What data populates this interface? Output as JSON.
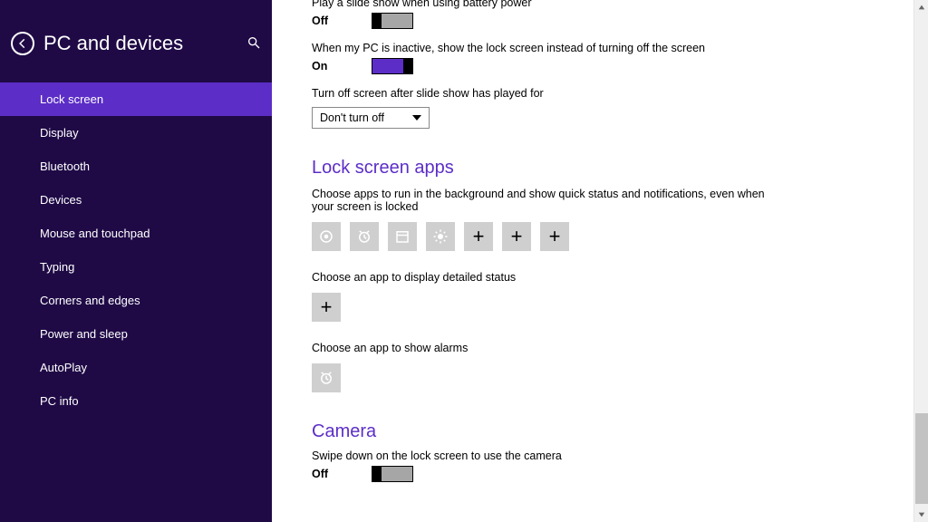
{
  "header": {
    "title": "PC and devices"
  },
  "sidebar": {
    "items": [
      "Lock screen",
      "Display",
      "Bluetooth",
      "Devices",
      "Mouse and touchpad",
      "Typing",
      "Corners and edges",
      "Power and sleep",
      "AutoPlay",
      "PC info"
    ],
    "active_index": 0
  },
  "slideshow": {
    "battery_label": "Play a slide show when using battery power",
    "battery_state": "Off",
    "inactive_label": "When my PC is inactive, show the lock screen instead of turning off the screen",
    "inactive_state": "On",
    "turnoff_label": "Turn off screen after slide show has played for",
    "turnoff_selected": "Don't turn off"
  },
  "apps": {
    "section_title": "Lock screen apps",
    "quick_desc": "Choose apps to run in the background and show quick status and notifications, even when your screen is locked",
    "detailed_label": "Choose an app to display detailed status",
    "alarms_label": "Choose an app to show alarms"
  },
  "camera": {
    "section_title": "Camera",
    "swipe_label": "Swipe down on the lock screen to use the camera",
    "swipe_state": "Off"
  }
}
